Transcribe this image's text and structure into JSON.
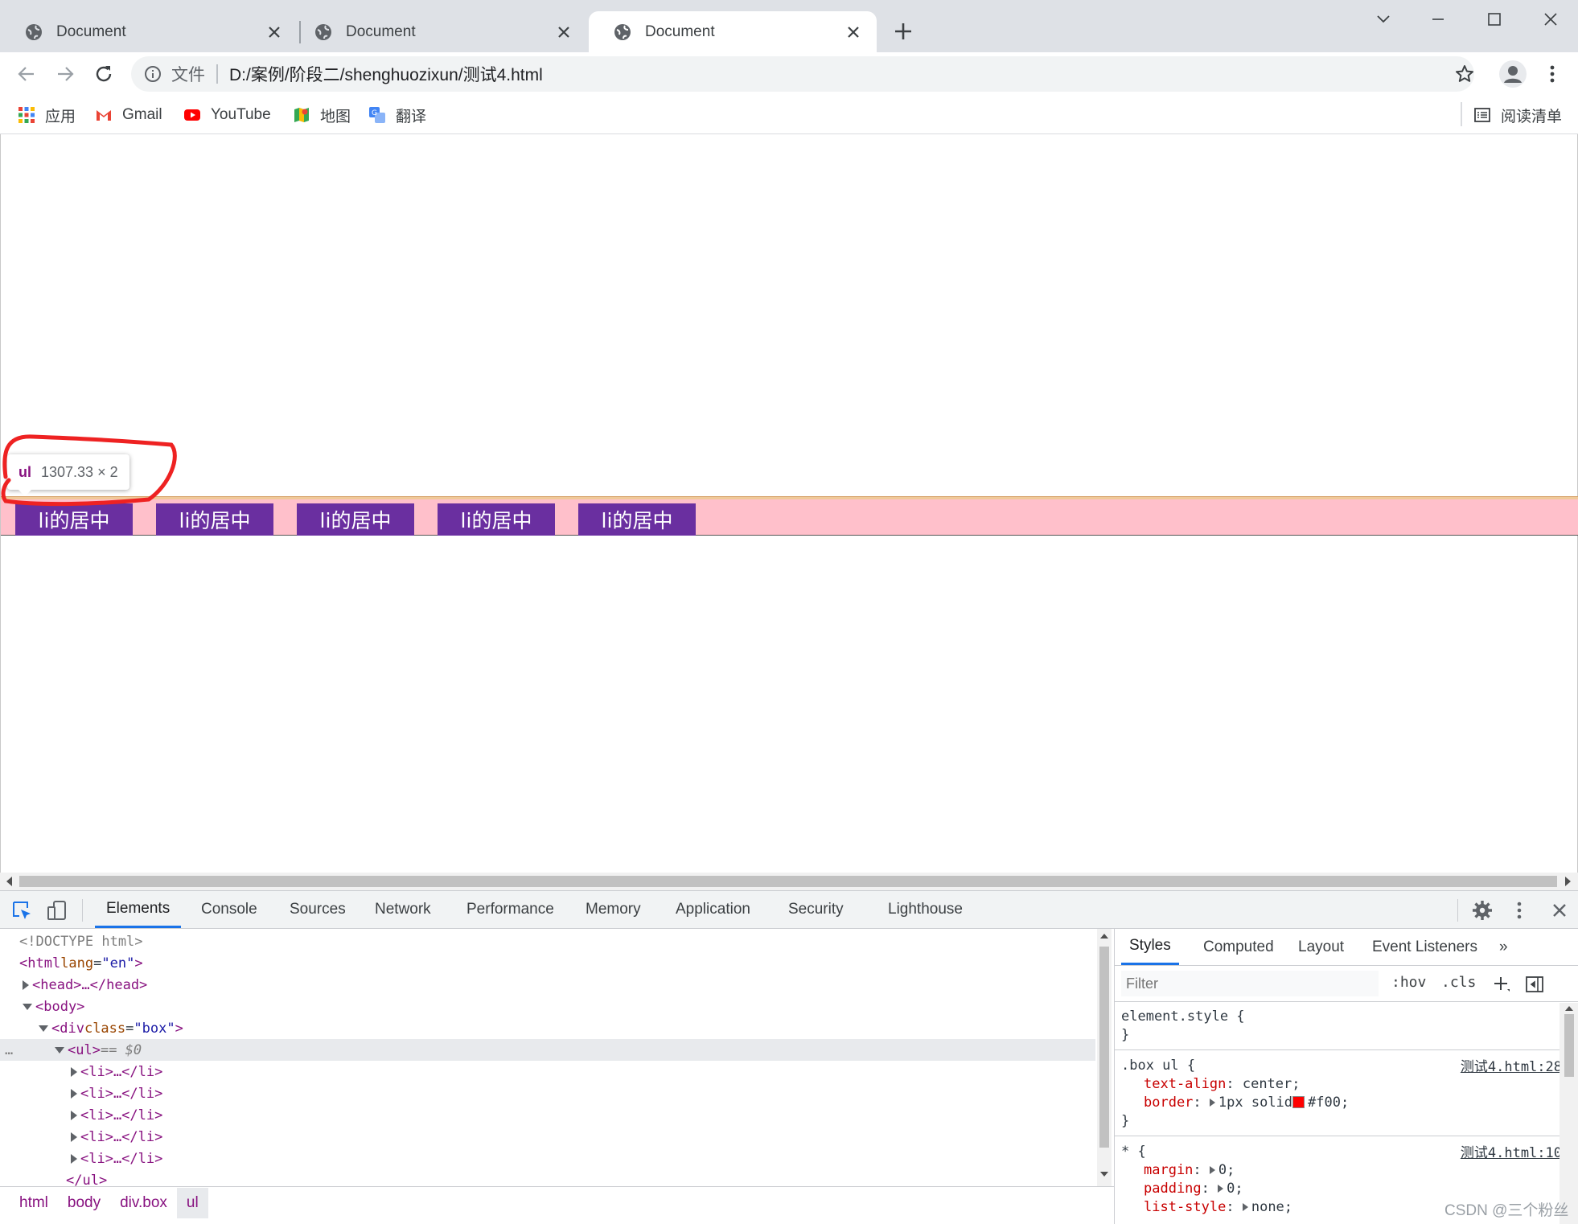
{
  "browser": {
    "tabs": [
      {
        "title": "Document",
        "active": false
      },
      {
        "title": "Document",
        "active": false
      },
      {
        "title": "Document",
        "active": true
      }
    ],
    "address": {
      "scheme_label": "文件",
      "url": "D:/案例/阶段二/shenghuozixun/测试4.html"
    },
    "bookmarks": [
      {
        "label": "应用",
        "icon": "apps-grid-icon"
      },
      {
        "label": "Gmail",
        "icon": "gmail-icon"
      },
      {
        "label": "YouTube",
        "icon": "youtube-icon"
      },
      {
        "label": "地图",
        "icon": "maps-icon"
      },
      {
        "label": "翻译",
        "icon": "translate-icon"
      }
    ],
    "reading_list": "阅读清单"
  },
  "page": {
    "li_items": [
      "li的居中",
      "li的居中",
      "li的居中",
      "li的居中",
      "li的居中"
    ],
    "tooltip": {
      "tag": "ul",
      "dimensions": "1307.33 × 2"
    },
    "colors": {
      "box_bg": "#ffc0cb",
      "li_bg": "#6a2fa0",
      "annotation": "#ee2222"
    }
  },
  "devtools": {
    "tabs": [
      "Elements",
      "Console",
      "Sources",
      "Network",
      "Performance",
      "Memory",
      "Application",
      "Security",
      "Lighthouse"
    ],
    "active_tab": "Elements",
    "dom": {
      "doctype": "<!DOCTYPE html>",
      "html_open": "<html",
      "lang_attr": "lang",
      "lang_val": "\"en\"",
      "html_close_br": ">",
      "head": "<head>…</head>",
      "body": "<body>",
      "div_open": "<div",
      "class_attr": "class",
      "class_val": "\"box\"",
      "div_close_br": ">",
      "ul": "<ul>",
      "selected_marker": "== $0",
      "li_collapsed": "<li>…</li>",
      "ul_close": "</ul>",
      "gutter_dots": "…"
    },
    "breadcrumbs": [
      "html",
      "body",
      "div.box",
      "ul"
    ],
    "styles_tabs": [
      "Styles",
      "Computed",
      "Layout",
      "Event Listeners"
    ],
    "styles_more": "»",
    "filter_placeholder": "Filter",
    "hov": ":hov",
    "cls": ".cls",
    "rules": {
      "element_style": {
        "selector": "element.style {",
        "close": "}"
      },
      "box_ul": {
        "selector": ".box ul {",
        "source": "测试4.html:28",
        "text_align_name": "text-align",
        "text_align_value": "center;",
        "border_name": "border",
        "border_value_a": "1px solid",
        "border_value_b": "#f00;",
        "close": "}"
      },
      "universal": {
        "selector": "* {",
        "source": "测试4.html:10",
        "margin_name": "margin",
        "margin_value": "0;",
        "padding_name": "padding",
        "padding_value": "0;",
        "list_style_name": "list-style",
        "list_style_value": "none;"
      }
    }
  },
  "watermark": "CSDN @三个粉丝"
}
